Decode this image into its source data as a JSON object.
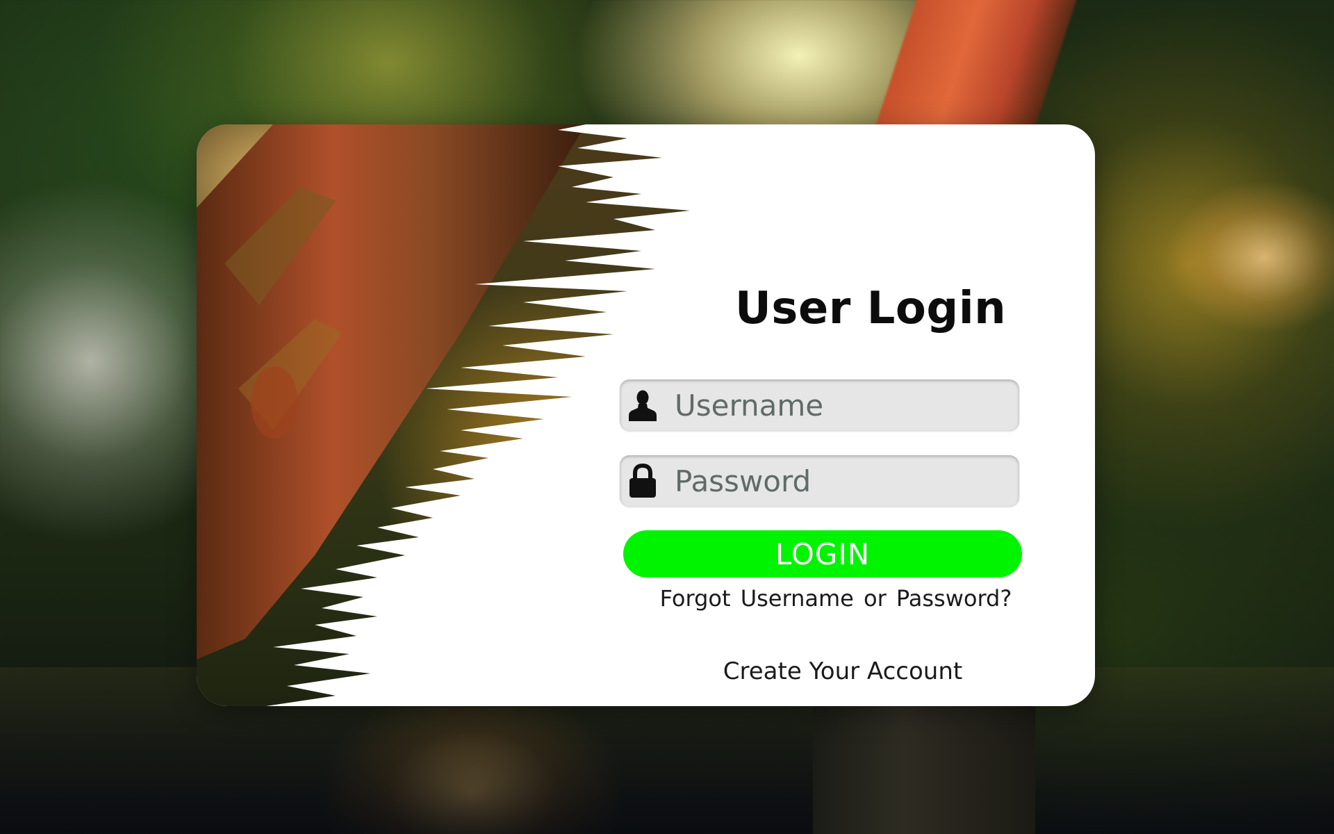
{
  "login_form": {
    "title": "User Login",
    "username_placeholder": "Username",
    "password_placeholder": "Password",
    "login_label": "LOGIN",
    "forgot_link": "Forgot  Username or  Password?",
    "create_account_link": "Create Your Account"
  },
  "colors": {
    "login_button": "#00f400",
    "input_background": "#e6e6e6",
    "placeholder_text": "#5f6b68",
    "card_background": "#ffffff"
  },
  "icons": {
    "username_field": "user-silhouette-icon",
    "password_field": "padlock-icon"
  }
}
